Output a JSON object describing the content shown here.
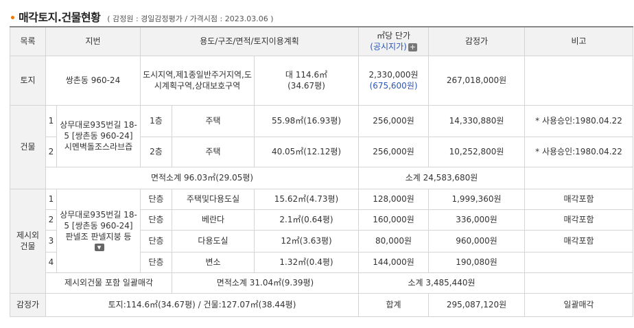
{
  "header": {
    "bullet": "•",
    "title": "매각토지.건물현황",
    "subtitle": "( 감정원 : 경일감정평가 / 가격시점 : 2023.03.06 )"
  },
  "columns": {
    "category": "목록",
    "lot": "지번",
    "usage": "용도/구조/면적/토지이용계획",
    "unit_price": "㎡당 단가",
    "official_price": "(공시지가)",
    "appraisal": "감정가",
    "note": "비고"
  },
  "land": {
    "label": "토지",
    "lot": "쌍촌동 960-24",
    "zoning": "도시지역,제1종일반주거지역,도시계획구역,상대보호구역",
    "area": "대 114.6㎡",
    "area_pyeong": "(34.67평)",
    "unit_price": "2,330,000원",
    "official_price": "(675,600원)",
    "appraisal": "267,018,000원",
    "note": ""
  },
  "building": {
    "label": "건물",
    "address": "상무대로935번길 18-5 [쌍촌동 960-24] 시멘벽돌조스라브즙",
    "rows": [
      {
        "no": "1",
        "floor": "1층",
        "use": "주택",
        "area": "55.98㎡(16.93평)",
        "unit_price": "256,000원",
        "appraisal": "14,330,880원",
        "note": "* 사용승인:1980.04.22"
      },
      {
        "no": "2",
        "floor": "2층",
        "use": "주택",
        "area": "40.05㎡(12.12평)",
        "unit_price": "256,000원",
        "appraisal": "10,252,800원",
        "note": "* 사용승인:1980.04.22"
      }
    ],
    "area_subtotal": "면적소계 96.03㎡(29.05평)",
    "subtotal": "소계 24,583,680원"
  },
  "extra": {
    "label_line1": "제시외",
    "label_line2": "건물",
    "address": "상무대로935번길 18-5 [쌍촌동 960-24] 판넬조 판넬지붕 등",
    "rows": [
      {
        "no": "1",
        "floor": "단층",
        "use": "주택및다용도실",
        "area": "15.62㎡(4.73평)",
        "unit_price": "128,000원",
        "appraisal": "1,999,360원",
        "note": "매각포함"
      },
      {
        "no": "2",
        "floor": "단층",
        "use": "베란다",
        "area": "2.1㎡(0.64평)",
        "unit_price": "160,000원",
        "appraisal": "336,000원",
        "note": "매각포함"
      },
      {
        "no": "3",
        "floor": "단층",
        "use": "다용도실",
        "area": "12㎡(3.63평)",
        "unit_price": "80,000원",
        "appraisal": "960,000원",
        "note": "매각포함"
      },
      {
        "no": "4",
        "floor": "단층",
        "use": "변소",
        "area": "1.32㎡(0.4평)",
        "unit_price": "144,000원",
        "appraisal": "190,080원",
        "note": ""
      }
    ],
    "included_note": "제시외건물 포함 일괄매각",
    "area_subtotal": "면적소계 31.04㎡(9.39평)",
    "subtotal": "소계 3,485,440원"
  },
  "total": {
    "label": "감정가",
    "summary": "토지:114.6㎡(34.67평) / 건물:127.07㎡(38.44평)",
    "sum_label": "합계",
    "amount": "295,087,120원",
    "note": "일괄매각"
  },
  "icons": {
    "expand_plus": "plus-box-icon",
    "expand_chevron": "chevron-down-box-icon"
  }
}
